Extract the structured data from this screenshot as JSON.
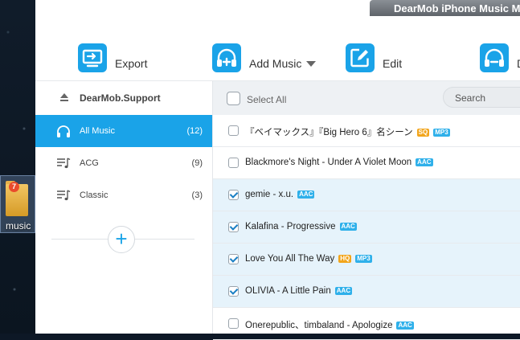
{
  "window": {
    "title": "DearMob iPhone Music M"
  },
  "desktop": {
    "folder_label": "music",
    "badge_count": "7",
    "info_glyph": "i"
  },
  "toolbar": {
    "export_label": "Export",
    "add_music_label": "Add Music",
    "edit_label": "Edit",
    "delete_label": "D"
  },
  "sidebar": {
    "device_name": "DearMob.Support",
    "items": [
      {
        "label": "All Music",
        "count": "(12)"
      },
      {
        "label": "ACG",
        "count": "(9)"
      },
      {
        "label": "Classic",
        "count": "(3)"
      }
    ],
    "add_symbol": "+"
  },
  "list": {
    "select_all_label": "Select All",
    "search_placeholder": "Search",
    "rows": [
      {
        "title": "『ベイマックス』『Big Hero 6』名シーン",
        "tags": [
          "SQ",
          "MP3"
        ],
        "checked": false
      },
      {
        "title": "Blackmore's Night - Under A Violet Moon",
        "tags": [
          "AAC"
        ],
        "checked": false
      },
      {
        "title": "gemie - x.u.",
        "tags": [
          "AAC"
        ],
        "checked": true
      },
      {
        "title": "Kalafina - Progressive",
        "tags": [
          "AAC"
        ],
        "checked": true
      },
      {
        "title": "Love You All The Way",
        "tags": [
          "HQ",
          "MP3"
        ],
        "checked": true
      },
      {
        "title": "OLIVIA - A Little Pain",
        "tags": [
          "AAC"
        ],
        "checked": true
      },
      {
        "title": "Onerepublic、timbaland - Apologize",
        "tags": [
          "AAC"
        ],
        "checked": false
      }
    ]
  },
  "colors": {
    "accent": "#1aa3e8",
    "selected_row": "#e6f3fb",
    "tag_blue": "#2fb0ea",
    "tag_orange": "#f2a51c"
  }
}
